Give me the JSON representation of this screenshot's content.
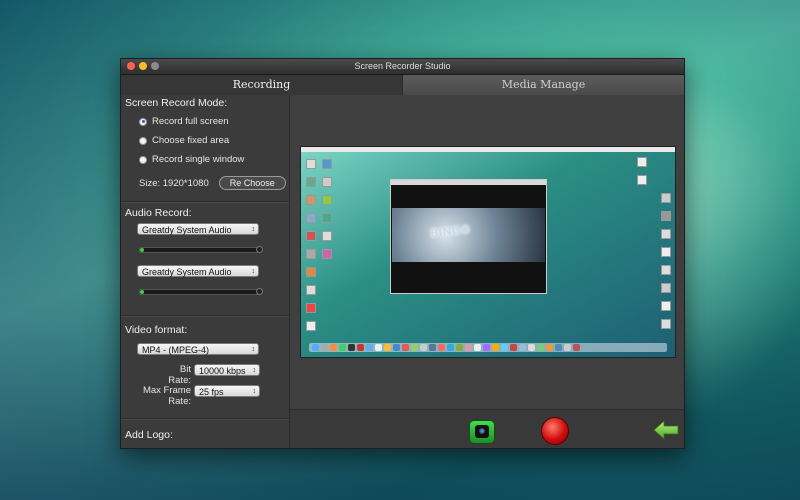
{
  "window": {
    "title": "Screen Recorder Studio",
    "tabs": [
      {
        "label": "Recording",
        "active": true
      },
      {
        "label": "Media Manage",
        "active": false
      }
    ]
  },
  "screen_record": {
    "title": "Screen Record Mode:",
    "options": [
      "Record full screen",
      "Choose fixed area",
      "Record single window"
    ],
    "selected_index": 0,
    "size_label": "Size: 1920*1080",
    "rechoose_label": "Re Choose"
  },
  "audio": {
    "title": "Audio Record:",
    "source1": "Greatdy System Audio",
    "level1_percent": 3,
    "source2": "Greatdy System Audio",
    "level2_percent": 3
  },
  "video": {
    "title": "Video format:",
    "format": "MP4 - (MPEG-4)",
    "bitrate_label": "Bit Rate:",
    "bitrate": "10000 kbps",
    "framerate_label": "Max Frame Rate:",
    "framerate": "25 fps"
  },
  "logo": {
    "title": "Add Logo:"
  },
  "colors": {
    "accent_green": "#3cd23c",
    "record_red": "#d10b0b",
    "panel": "#3b3b3b"
  },
  "icons": {
    "capture": "camera-icon",
    "record": "record-icon",
    "back": "back-arrow-icon"
  }
}
